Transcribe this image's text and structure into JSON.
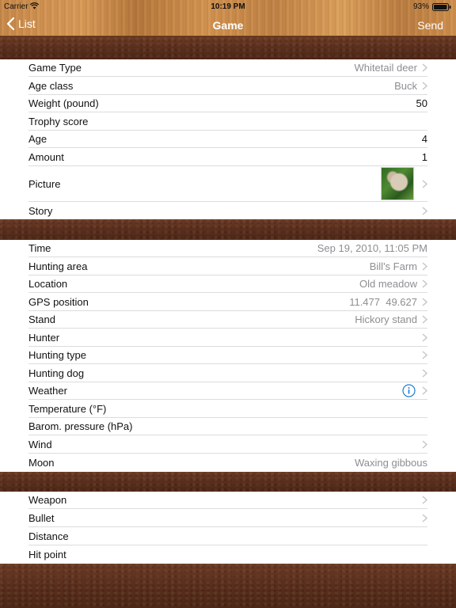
{
  "status": {
    "carrier": "Carrier",
    "time": "10:19 PM",
    "battery": "93%"
  },
  "nav": {
    "back_label": "List",
    "title": "Game",
    "send_label": "Send"
  },
  "sections": [
    {
      "rows": [
        {
          "label": "Game Type",
          "value": "Whitetail deer",
          "chevron": true
        },
        {
          "label": "Age class",
          "value": "Buck",
          "chevron": true
        },
        {
          "label": "Weight (pound)",
          "value": "50",
          "chevron": false,
          "dark": true
        },
        {
          "label": "Trophy score",
          "value": "",
          "chevron": false
        },
        {
          "label": "Age",
          "value": "4",
          "chevron": false,
          "dark": true
        },
        {
          "label": "Amount",
          "value": "1",
          "chevron": false,
          "dark": true
        },
        {
          "label": "Picture",
          "value": "",
          "chevron": true,
          "thumbnail": "deer-photo"
        },
        {
          "label": "Story",
          "value": "",
          "chevron": true
        }
      ]
    },
    {
      "rows": [
        {
          "label": "Time",
          "value": "Sep 19, 2010, 11:05 PM",
          "chevron": false
        },
        {
          "label": "Hunting area",
          "value": "Bill's Farm",
          "chevron": true
        },
        {
          "label": "Location",
          "value": "Old meadow",
          "chevron": true
        },
        {
          "label": "GPS position",
          "value": "11.477  49.627",
          "chevron": true
        },
        {
          "label": "Stand",
          "value": "Hickory stand",
          "chevron": true
        },
        {
          "label": "Hunter",
          "value": "",
          "chevron": true
        },
        {
          "label": "Hunting type",
          "value": "",
          "chevron": true
        },
        {
          "label": "Hunting dog",
          "value": "",
          "chevron": true
        },
        {
          "label": "Weather",
          "value": "",
          "chevron": true,
          "icon": "info-icon"
        },
        {
          "label": "Temperature (°F)",
          "value": "",
          "chevron": false
        },
        {
          "label": "Barom. pressure (hPa)",
          "value": "",
          "chevron": false
        },
        {
          "label": "Wind",
          "value": "",
          "chevron": true
        },
        {
          "label": "Moon",
          "value": "Waxing gibbous",
          "chevron": false
        }
      ]
    },
    {
      "rows": [
        {
          "label": "Weapon",
          "value": "",
          "chevron": true
        },
        {
          "label": "Bullet",
          "value": "",
          "chevron": true
        },
        {
          "label": "Distance",
          "value": "",
          "chevron": false
        },
        {
          "label": "Hit point",
          "value": "",
          "chevron": false
        }
      ]
    }
  ],
  "colors": {
    "accent": "#1a7fd6",
    "value_gray": "#8e8e93",
    "leather": "#5a2e1c",
    "wood": "#c98a4a"
  }
}
